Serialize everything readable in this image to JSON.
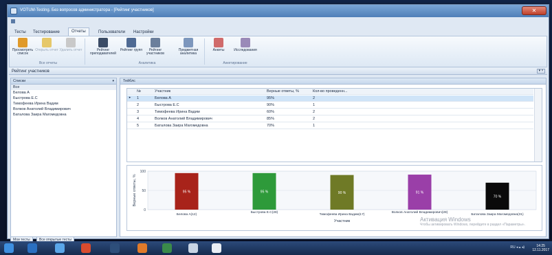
{
  "window": {
    "title": "VOTUM-Testing. Без вопросов администратора - [Рейтинг участников]",
    "close_label": "✕"
  },
  "tabs": [
    {
      "label": "Тесты"
    },
    {
      "label": "Тестирование"
    },
    {
      "label": "Отчеты"
    },
    {
      "label": "Пользователи"
    },
    {
      "label": "Настройки"
    }
  ],
  "ribbon": {
    "buttons": [
      {
        "label": "Просмотреть список",
        "icon": "view-list-icon",
        "color": "#e09a2a"
      },
      {
        "label": "Открыть отчет",
        "icon": "open-report-icon",
        "color": "#e6c86a"
      },
      {
        "label": "Удалить отчет",
        "icon": "delete-report-icon",
        "color": "#c9c9c9"
      },
      {
        "label": "Рейтинг преподавателей",
        "icon": "teacher-rating-icon",
        "color": "#3b4c66"
      },
      {
        "label": "Рейтинг групп",
        "icon": "group-rating-icon",
        "color": "#4f6a93"
      },
      {
        "label": "Рейтинг участников",
        "icon": "participant-rating-icon",
        "color": "#6b7f9c"
      },
      {
        "label": "Предметная аналитика",
        "icon": "analytics-icon",
        "color": "#7d97bd"
      },
      {
        "label": "Анкеты",
        "icon": "survey-icon",
        "color": "#d06b6b"
      },
      {
        "label": "Исследования",
        "icon": "research-icon",
        "color": "#9a8ab8"
      }
    ],
    "groups": [
      {
        "label": "Все отчеты"
      },
      {
        "label": "Аналитика"
      },
      {
        "label": "Анкетирование"
      }
    ]
  },
  "docbar": {
    "label": "Рейтинг участников",
    "pin": "▾ ×"
  },
  "left_panel": {
    "header": "Списки",
    "items": [
      {
        "label": "Все"
      },
      {
        "label": "Белова А"
      },
      {
        "label": "Быстрова Е.С"
      },
      {
        "label": "Тимофеева Ирина Вадим"
      },
      {
        "label": "Волков Анатолий Владимирович"
      },
      {
        "label": "Баталова Заира Магомедовна"
      }
    ]
  },
  "results": {
    "header": "Тейблс",
    "columns": [
      "№",
      "Участник",
      "Верные ответы, %",
      "Кол-во проведенн..."
    ],
    "rows": [
      {
        "num": "1",
        "name": "Белова А",
        "pct": "95%",
        "count": "2",
        "selected": true
      },
      {
        "num": "2",
        "name": "Быстрова Е.С",
        "pct": "90%",
        "count": "1",
        "selected": false
      },
      {
        "num": "3",
        "name": "Тимофеева Ирина Вадим",
        "pct": "60%",
        "count": "2",
        "selected": false
      },
      {
        "num": "4",
        "name": "Волков Анатолий Владимирович",
        "pct": "85%",
        "count": "2",
        "selected": false
      },
      {
        "num": "5",
        "name": "Баталова Заира Магомедовна",
        "pct": "70%",
        "count": "1",
        "selected": false
      }
    ]
  },
  "chart_data": {
    "type": "bar",
    "categories": [
      "Белова А(12)",
      "Быстрова Е.С(28)",
      "Тимофеева Ирина Вадим(17)",
      "Волков Анатолий Владимирович(28)",
      "Баталова Заира Магомедовна(31)"
    ],
    "values": [
      95,
      95,
      90,
      91,
      70
    ],
    "data_labels": [
      "95 %",
      "95 %",
      "90 %",
      "91 %",
      "70 %"
    ],
    "colors": [
      "#a8231a",
      "#2e9a3a",
      "#6f7a26",
      "#9a3fa8",
      "#0a0a0a"
    ],
    "ylim": [
      0,
      100
    ],
    "yticks": [
      "100",
      "50",
      "0"
    ],
    "ylabel": "Верные ответы, %",
    "xlabel": "Участник"
  },
  "bottom_tabs": [
    {
      "label": "Мои тесты"
    },
    {
      "label": "Все открытые тесты"
    }
  ],
  "watermark": {
    "line1": "Активация Windows",
    "line2": "Чтобы активировать Windows, перейдите в раздел «Параметры»."
  },
  "taskbar": {
    "tray": "RU ◂ ▴ ◂)",
    "time": "14:25",
    "date": "12.11.2017"
  }
}
